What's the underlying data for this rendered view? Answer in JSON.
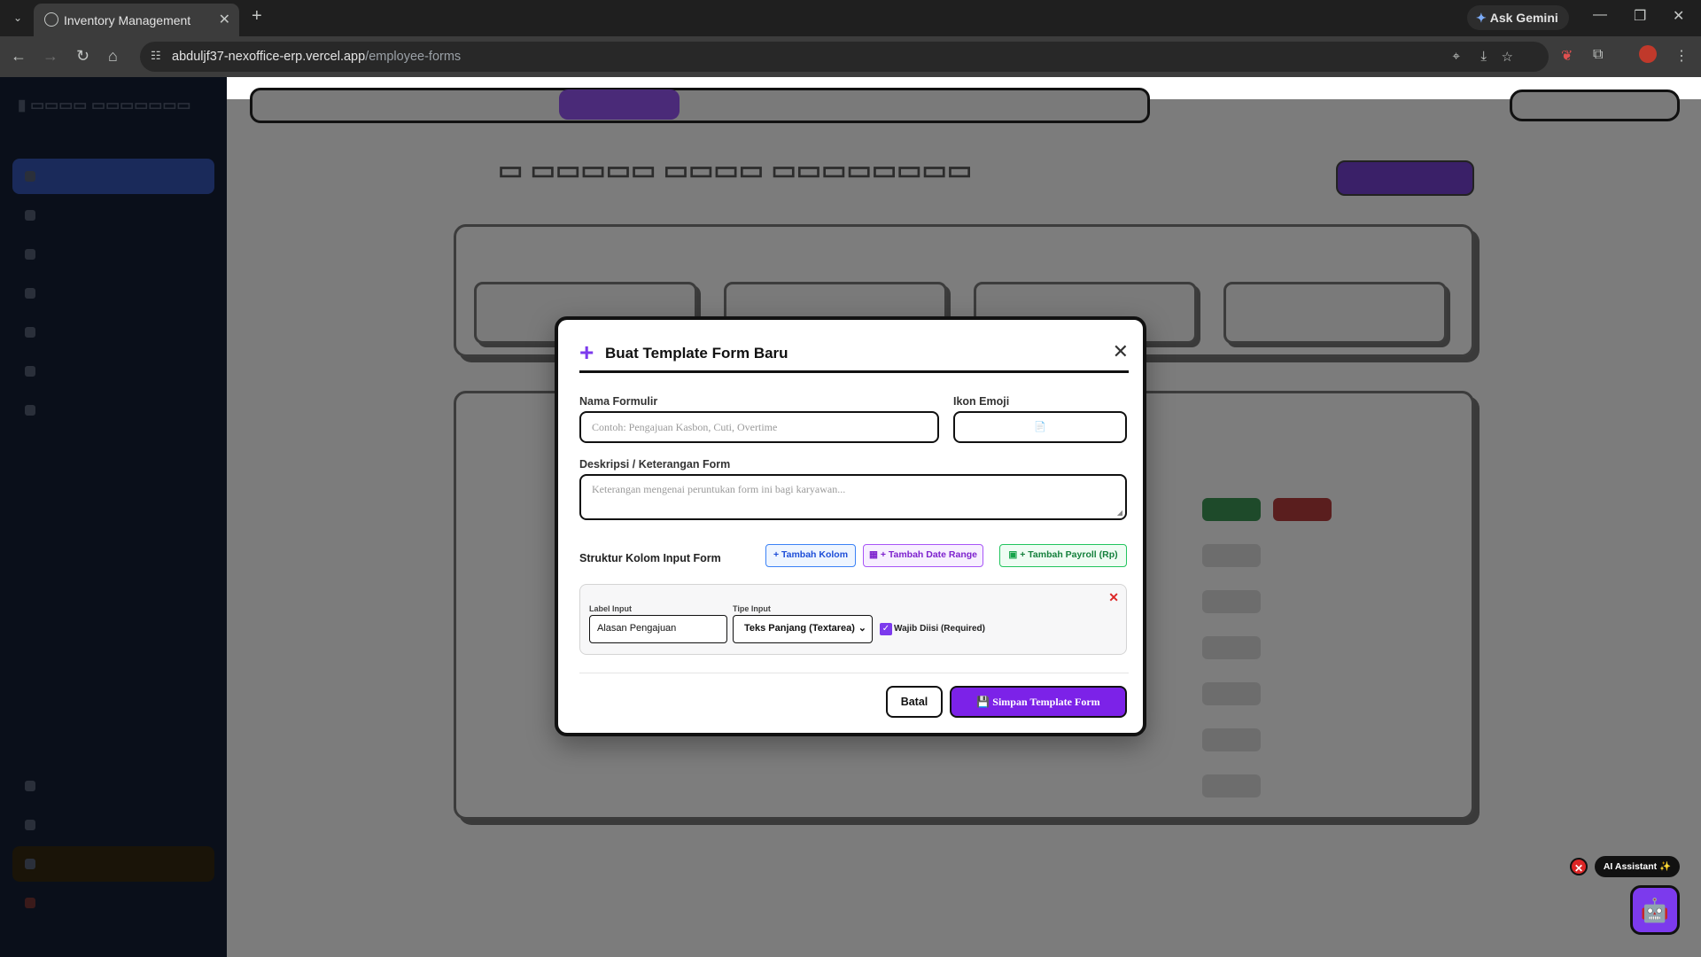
{
  "browser": {
    "tab_title": "Inventory Management",
    "ask_gemini": "Ask Gemini",
    "url_host": "abduljf37-nexoffice-erp.vercel.app",
    "url_path": "/employee-forms"
  },
  "modal": {
    "title": "Buat Template Form Baru",
    "name_label": "Nama Formulir",
    "name_placeholder": "Contoh: Pengajuan Kasbon, Cuti, Overtime",
    "emoji_label": "Ikon Emoji",
    "emoji_value": "📄",
    "desc_label": "Deskripsi / Keterangan Form",
    "desc_placeholder": "Keterangan mengenai peruntukan form ini bagi karyawan...",
    "structure_label": "Struktur Kolom Input Form",
    "add_column": "+ Tambah Kolom",
    "add_date_range": "+ Tambah Date Range",
    "add_payroll": "+ Tambah Payroll (Rp)",
    "field": {
      "label_title": "Label Input",
      "label_value": "Alasan Pengajuan",
      "type_title": "Tipe Input",
      "type_value": "Teks Panjang (Textarea)",
      "required_label": "Wajib Diisi (Required)",
      "required_checked": true
    },
    "cancel": "Batal",
    "save": "Simpan Template Form"
  },
  "ai_assistant": {
    "label": "AI Assistant ✨"
  },
  "icons": {
    "plus": "plus-icon",
    "close": "close-icon",
    "calendar": "calendar-icon",
    "money": "money-icon",
    "save": "floppy-icon",
    "robot": "robot-icon"
  },
  "colors": {
    "accent": "#7c3aed",
    "danger": "#dc2626"
  }
}
